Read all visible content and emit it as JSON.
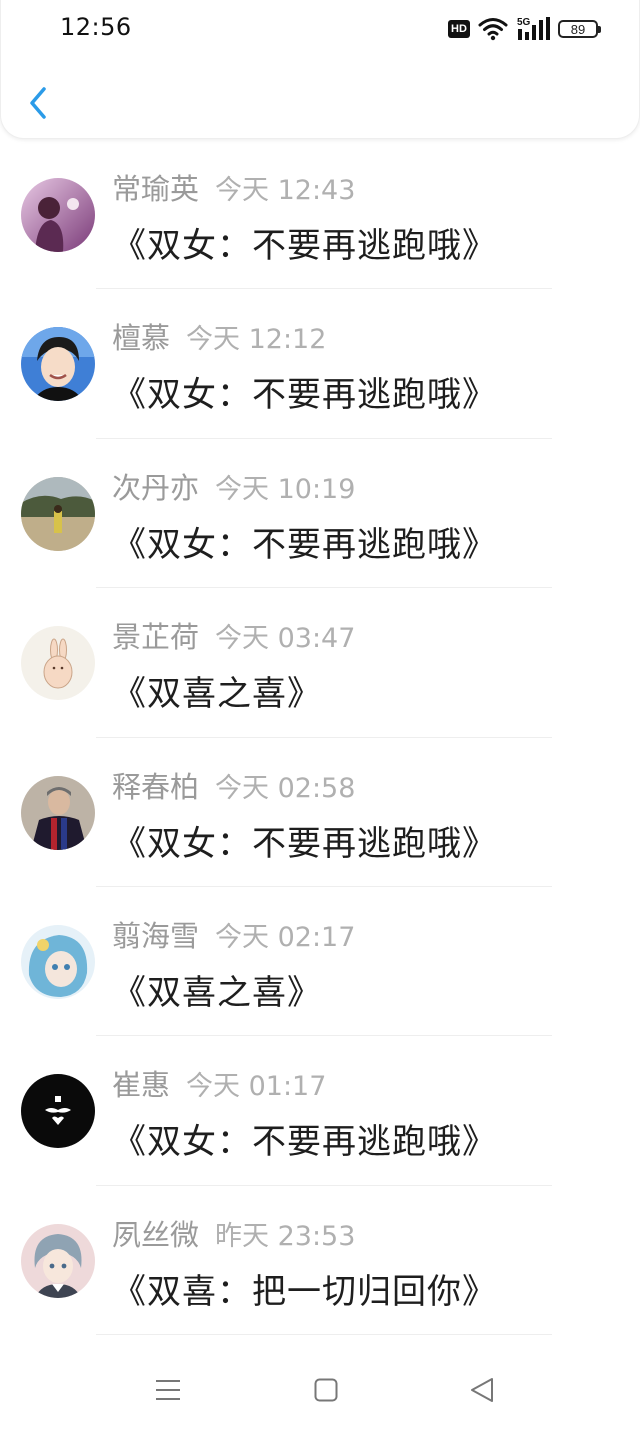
{
  "status_bar": {
    "time": "12:56",
    "hd": "HD",
    "network": "5G",
    "battery": "89",
    "icons": [
      "hd-icon",
      "wifi-icon",
      "signal-icon",
      "battery-icon"
    ]
  },
  "header": {
    "back_icon": "chevron-left-icon",
    "accent": "#2b9be8"
  },
  "items": [
    {
      "name": "常瑜英",
      "time": "今天 12:43",
      "title": "《双女：不要再逃跑哦》"
    },
    {
      "name": "檀慕",
      "time": "今天 12:12",
      "title": "《双女：不要再逃跑哦》"
    },
    {
      "name": "次丹亦",
      "time": "今天 10:19",
      "title": "《双女：不要再逃跑哦》"
    },
    {
      "name": "景芷荷",
      "time": "今天 03:47",
      "title": "《双喜之喜》"
    },
    {
      "name": "释春柏",
      "time": "今天 02:58",
      "title": "《双女：不要再逃跑哦》"
    },
    {
      "name": "翦海雪",
      "time": "今天 02:17",
      "title": "《双喜之喜》"
    },
    {
      "name": "崔惠",
      "time": "今天 01:17",
      "title": "《双女：不要再逃跑哦》"
    },
    {
      "name": "夙丝微",
      "time": "昨天 23:53",
      "title": "《双喜：把一切归回你》"
    }
  ],
  "nav_bar": {
    "icons": [
      "menu-icon",
      "home-icon",
      "back-triangle-icon"
    ]
  }
}
